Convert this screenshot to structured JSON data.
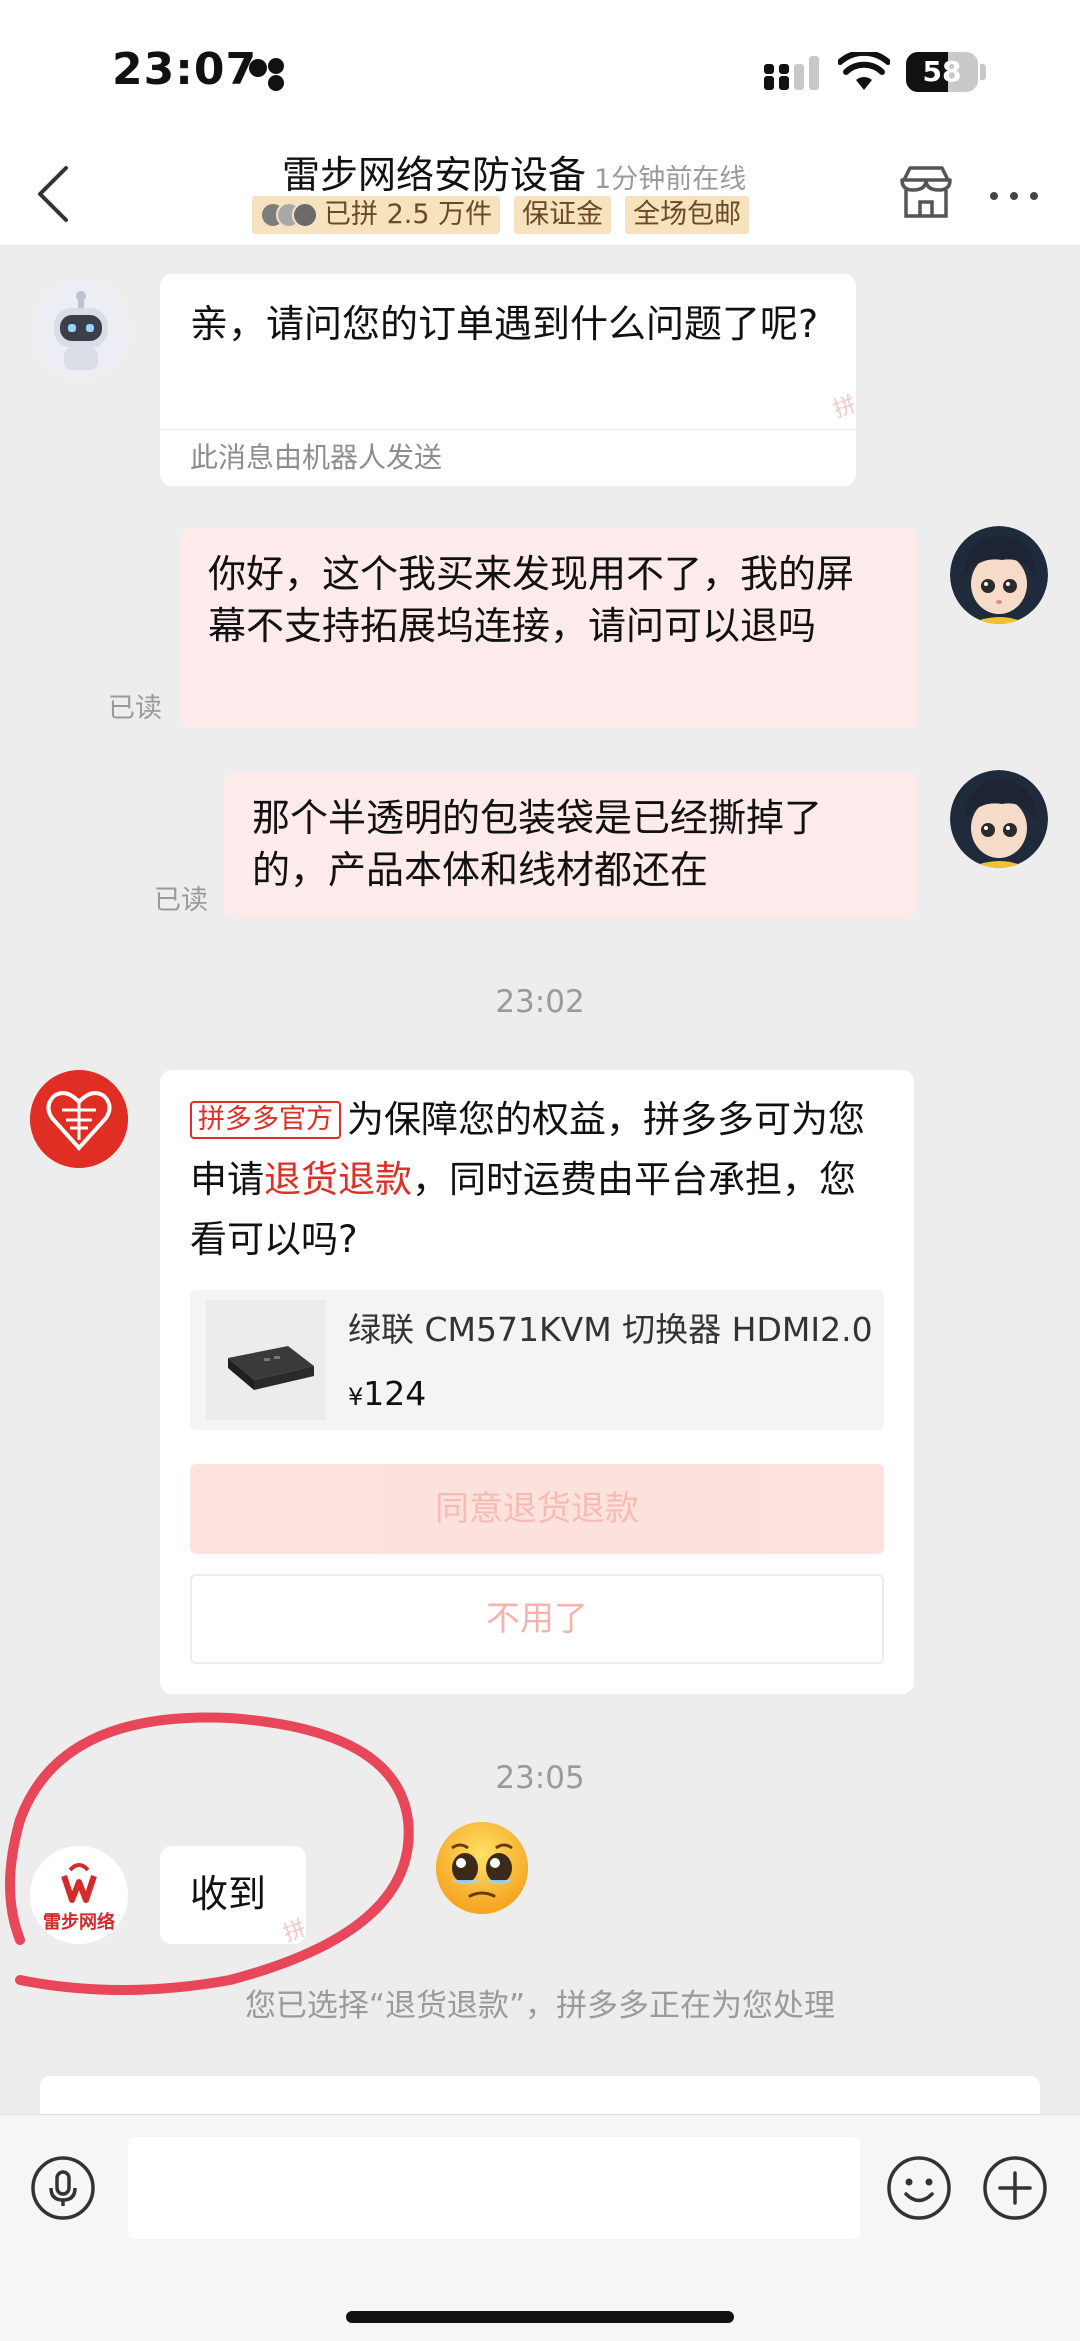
{
  "status_bar": {
    "time": "23:07",
    "battery": "58"
  },
  "header": {
    "back_icon": "chevron-left-icon",
    "shop_name": "雷步网络安防设备",
    "online_status": "1分钟前在线",
    "tags": [
      "已拼 2.5 万件",
      "保证金",
      "全场包邮"
    ],
    "store_icon": "store-icon",
    "more_icon": "more-dots-icon"
  },
  "messages": [
    {
      "sender": "bot",
      "text": "亲，请问您的订单遇到什么问题了呢?",
      "note": "此消息由机器人发送"
    },
    {
      "sender": "me",
      "text": "你好，这个我买来发现用不了，我的屏幕不支持拓展坞连接，请问可以退吗",
      "status": "已读"
    },
    {
      "sender": "me",
      "text": "那个半透明的包装袋是已经撕掉了的，产品本体和线材都还在",
      "status": "已读"
    }
  ],
  "timestamps": [
    "23:02",
    "23:05"
  ],
  "official_card": {
    "badge": "拼多多官方",
    "text_before": "为保障您的权益，拼多多可为您申请",
    "highlight": "退货退款",
    "text_after": "，同时运费由平台承担，您看可以吗?",
    "product": {
      "name": "绿联 CM571KVM 切换器 HDMI2.0",
      "currency": "¥",
      "price": "124"
    },
    "agree_button": "同意退货退款",
    "decline_button": "不用了"
  },
  "seller_reply": {
    "avatar_label": "雷步网络",
    "text": "收到"
  },
  "watermark": "拼",
  "system_notice": "您已选择“退货退款”，拼多多正在为您处理",
  "input_bar": {
    "voice_icon": "microphone-icon",
    "emoji_icon": "smiley-icon",
    "plus_icon": "plus-icon",
    "placeholder": ""
  },
  "colors": {
    "brand_red": "#e02e24",
    "bubble_mine": "#fdeaea",
    "annotation_circle": "#e8475a"
  }
}
